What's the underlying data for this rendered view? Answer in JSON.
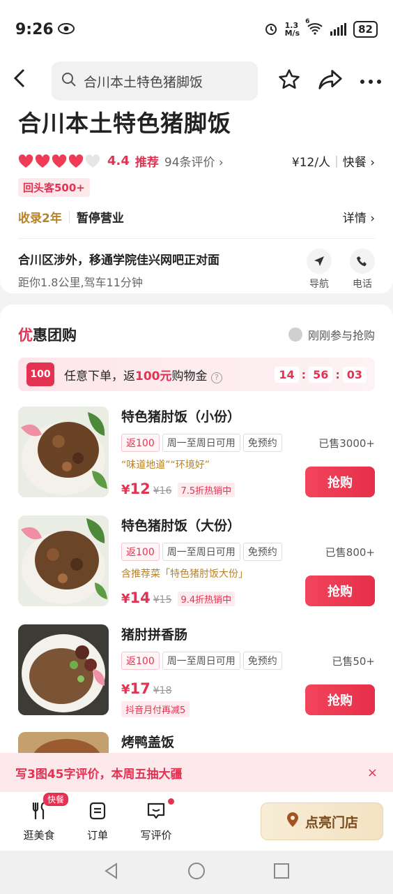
{
  "status": {
    "time": "9:26",
    "net_speed_top": "1.3",
    "net_speed_unit": "M/s",
    "wifi_num": "6",
    "battery": "82"
  },
  "search": {
    "text": "合川本土特色猪脚饭"
  },
  "shop": {
    "title": "合川本土特色猪脚饭",
    "score": "4.4",
    "recommend": "推荐",
    "reviews": "94条评价 ›",
    "price": "¥12/人",
    "category": "快餐 ›",
    "repeat_badge": "回头客500+",
    "years": "收录2年",
    "status": "暂停营业",
    "detail": "详情 ›",
    "address": "合川区涉外，移通学院佳兴网吧正对面",
    "distance": "距你1.8公里,驾车11分钟",
    "nav_label": "导航",
    "phone_label": "电话"
  },
  "deals": {
    "title_accent": "优",
    "title_rest": "惠团购",
    "joined": "刚刚参与抢购",
    "promo_icon": "100",
    "promo_pre": "任意下单，返",
    "promo_highlight": "100元",
    "promo_post": "购物金",
    "countdown": {
      "h": "14",
      "m": "56",
      "s": "03"
    },
    "items": [
      {
        "name": "特色猪肘饭（小份）",
        "tag_return": "返100",
        "tag_days": "周一至周日可用",
        "tag_reserve": "免预约",
        "sold": "已售3000+",
        "note": "“味道地道”“环境好”",
        "currency": "¥",
        "price": "12",
        "old_price": "¥16",
        "discount": "7.5折热销中",
        "buy": "抢购"
      },
      {
        "name": "特色猪肘饭（大份）",
        "tag_return": "返100",
        "tag_days": "周一至周日可用",
        "tag_reserve": "免预约",
        "sold": "已售800+",
        "note": "含推荐菜「特色猪肘饭大份」",
        "currency": "¥",
        "price": "14",
        "old_price": "¥15",
        "discount": "9.4折热销中",
        "buy": "抢购"
      },
      {
        "name": "猪肘拼香肠",
        "tag_return": "返100",
        "tag_days": "周一至周日可用",
        "tag_reserve": "免预约",
        "sold": "已售50+",
        "currency": "¥",
        "price": "17",
        "old_price": "¥18",
        "douyin": "抖音月付再减5",
        "buy": "抢购"
      },
      {
        "name": "烤鸭盖饭"
      }
    ]
  },
  "review_banner": {
    "text": "写3图45字评价，本周五抽大疆",
    "close": "×"
  },
  "bottom_nav": {
    "browse": "逛美食",
    "browse_badge": "快餐",
    "orders": "订单",
    "write_review": "写评价",
    "light_up": "点亮门店"
  },
  "colors": {
    "accent": "#e33252",
    "gold": "#b8822b"
  }
}
